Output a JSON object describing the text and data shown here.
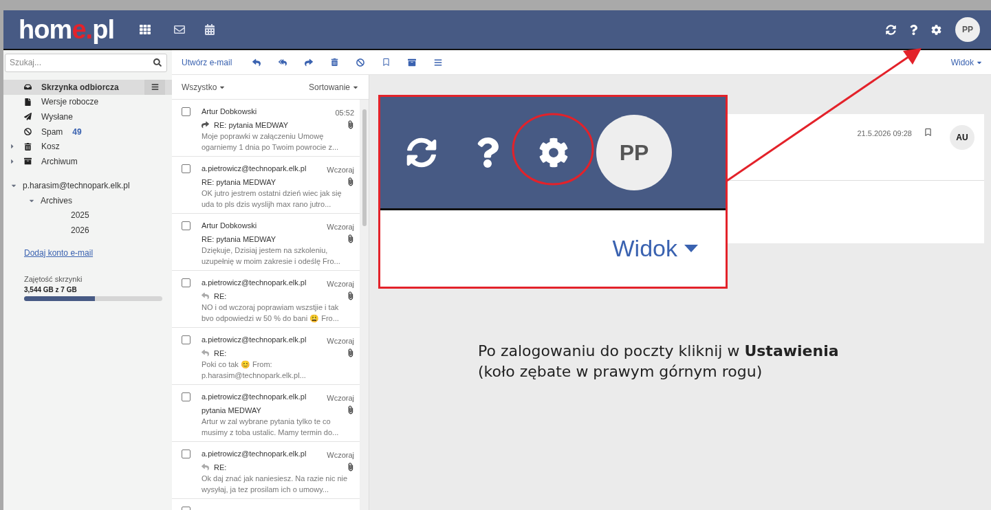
{
  "header": {
    "logo": [
      {
        "text": "hom",
        "kind": "plain"
      },
      {
        "text": "e",
        "kind": "accent"
      },
      {
        "text": ".",
        "kind": "accent"
      },
      {
        "text": "pl",
        "kind": "plain"
      }
    ],
    "avatar": "PP"
  },
  "search": {
    "placeholder": "Szukaj..."
  },
  "toolbar": {
    "compose": "Utwórz e-mail",
    "view": "Widok"
  },
  "folders": [
    {
      "label": "Skrzynka odbiorcza",
      "kind": "inbox",
      "selected": true
    },
    {
      "label": "Wersje robocze",
      "kind": "draft",
      "selected": false
    },
    {
      "label": "Wysłane",
      "kind": "sent",
      "selected": false
    },
    {
      "label": "Spam",
      "kind": "spam",
      "selected": false,
      "count": "49"
    },
    {
      "label": "Kosz",
      "kind": "trash",
      "selected": false,
      "expanded": false
    },
    {
      "label": "Archiwum",
      "kind": "archive",
      "selected": false,
      "expanded": false
    }
  ],
  "accounts": [
    {
      "label": "p.harasim@technopark.elk.pl",
      "expanded": true,
      "children": [
        {
          "label": "Archives",
          "expanded": true,
          "children": [
            {
              "label": "2025"
            },
            {
              "label": "2026"
            }
          ]
        }
      ]
    }
  ],
  "add_account": "Dodaj konto e-mail",
  "storage": {
    "label": "Zajętość skrzynki",
    "reading": "3,544 GB z 7 GB",
    "level": 0.51
  },
  "list": {
    "filter": "Wszystko",
    "sort": "Sortowanie"
  },
  "messages": [
    {
      "sender": "Artur Dobkowski",
      "time": "05:52",
      "kind": "forwarded",
      "subject": "RE: pytania MEDWAY",
      "preview": "Moje poprawki w załączeniu Umowę ogarniemy 1 dnia po Twoim powrocie z...",
      "attachment": true,
      "checked": false
    },
    {
      "sender": "a.pietrowicz@technopark.elk.pl",
      "time": "Wczoraj",
      "kind": "plain",
      "subject": "RE: pytania MEDWAY",
      "preview": "OK jutro jestrem ostatni dzień wiec jak się uda to pls dzis wyslijh max rano jutro...",
      "attachment": true,
      "checked": false
    },
    {
      "sender": "Artur Dobkowski",
      "time": "Wczoraj",
      "kind": "plain",
      "subject": "RE: pytania MEDWAY",
      "preview": "Dziękuje, Dzisiaj jestem na szkoleniu, uzupełnię w moim zakresie i odeślę Fro...",
      "attachment": true,
      "checked": false
    },
    {
      "sender": "a.pietrowicz@technopark.elk.pl",
      "time": "Wczoraj",
      "kind": "replied",
      "subject": "RE:",
      "preview": "NO i od wczoraj poprawiam wszstjie i tak bvo odpowiedzi w 50 % do bani 😩 Fro...",
      "attachment": true,
      "checked": false
    },
    {
      "sender": "a.pietrowicz@technopark.elk.pl",
      "time": "Wczoraj",
      "kind": "replied",
      "subject": "RE:",
      "preview": "Poki co tak 😊 From: p.harasim@technopark.elk.pl...",
      "attachment": true,
      "checked": false
    },
    {
      "sender": "a.pietrowicz@technopark.elk.pl",
      "time": "Wczoraj",
      "kind": "plain",
      "subject": "pytania MEDWAY",
      "preview": "Artur w zal wybrane pytania tylko te co musimy z toba ustalic. Mamy termin do...",
      "attachment": true,
      "checked": false
    },
    {
      "sender": "a.pietrowicz@technopark.elk.pl",
      "time": "Wczoraj",
      "kind": "replied",
      "subject": "RE:",
      "preview": "Ok daj znać jak naniesiesz. Na razie nic nie wysyłaj, ja tez prosilam ich o umowy...",
      "attachment": true,
      "checked": false
    },
    {
      "kind": "plain",
      "checked": false
    }
  ],
  "message": {
    "date": "21.5.2026 09:28",
    "avatar": "AU"
  },
  "callout": {
    "avatar": "PP",
    "view": "Widok"
  },
  "instruction": [
    "Po zalogowaniu do poczty kliknij w **Ustawienia**",
    "(koło zębate w prawym górnym rogu)"
  ]
}
